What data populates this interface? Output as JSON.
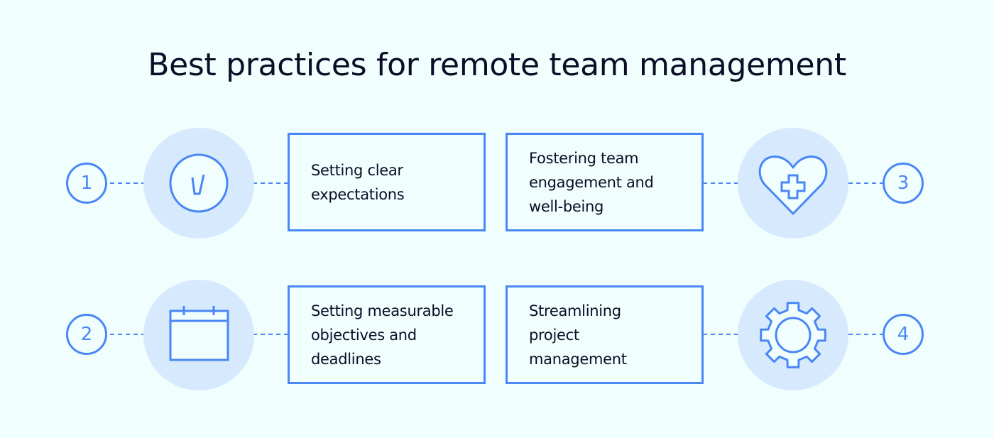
{
  "title": "Best practices for remote team management",
  "colors": {
    "accent": "#4a87f5",
    "circle_bg": "#d7eafd",
    "background": "#f0fefe"
  },
  "items": [
    {
      "number": "1",
      "icon": "checkmark-circle-icon",
      "label": "Setting clear\nexpectations"
    },
    {
      "number": "2",
      "icon": "calendar-icon",
      "label": "Setting measurable\nobjectives and\ndeadlines"
    },
    {
      "number": "3",
      "icon": "heart-plus-icon",
      "label": "Fostering team\nengagement and\nwell-being"
    },
    {
      "number": "4",
      "icon": "gear-icon",
      "label": "Streamlining\nproject\nmanagement"
    }
  ]
}
